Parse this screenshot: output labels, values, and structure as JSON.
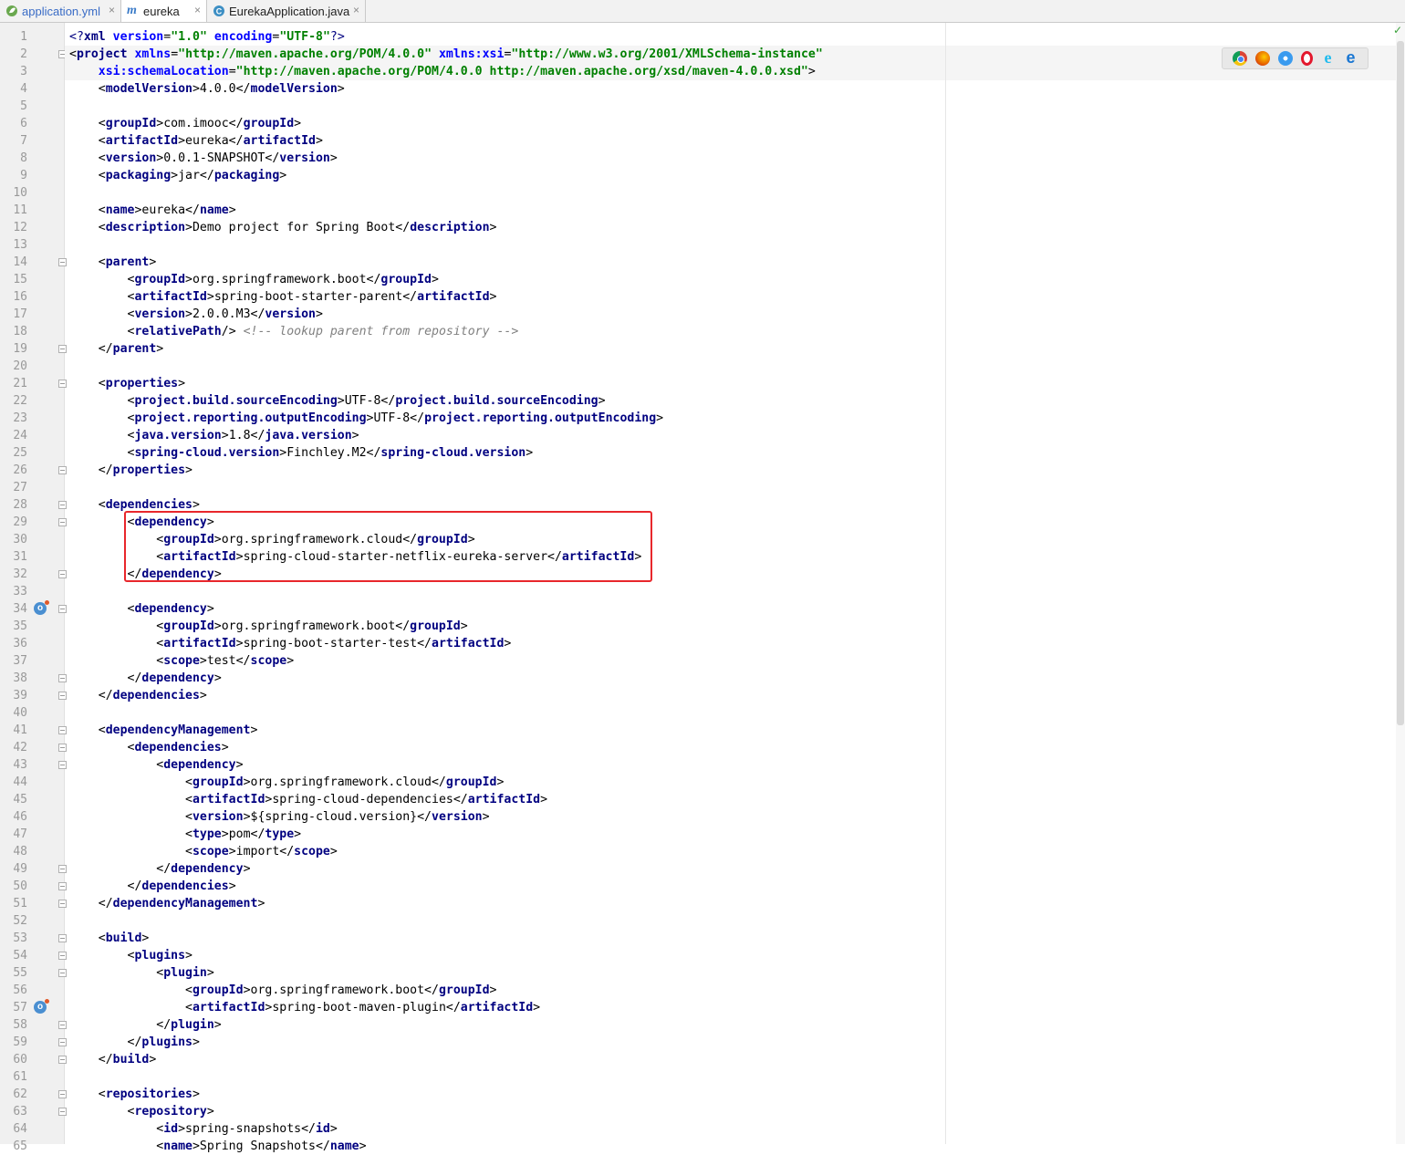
{
  "tabs": [
    {
      "label": "application.yml",
      "icon": "yaml-leaf-icon",
      "active": false
    },
    {
      "label": "eureka",
      "icon": "maven-m-icon",
      "active": true
    },
    {
      "label": "EurekaApplication.java",
      "icon": "java-class-icon",
      "active": false
    }
  ],
  "tab_close_glyph": "×",
  "status_check": "✓",
  "browser_icons": [
    "chrome-icon",
    "firefox-icon",
    "safari-icon",
    "opera-icon",
    "ie-icon",
    "edge-icon"
  ],
  "gutter_icons": [
    {
      "line": 34,
      "name": "run-override-icon"
    },
    {
      "line": 57,
      "name": "run-override-icon"
    }
  ],
  "fold_lines": [
    2,
    14,
    19,
    21,
    26,
    28,
    29,
    32,
    34,
    38,
    39,
    41,
    42,
    43,
    49,
    50,
    51,
    53,
    54,
    55,
    58,
    59,
    60,
    62,
    63
  ],
  "highlight_box": {
    "color": "#e8272c",
    "lines": [
      29,
      32
    ]
  },
  "colors": {
    "tag": "#000080",
    "attribute": "#0000ff",
    "value": "#008000",
    "comment": "#808080"
  },
  "code_lines": [
    [
      {
        "t": "<?",
        "c": "pi"
      },
      {
        "t": "xml ",
        "c": "tag"
      },
      {
        "t": "version",
        "c": "att"
      },
      {
        "t": "=",
        "c": ""
      },
      {
        "t": "\"1.0\"",
        "c": "val"
      },
      {
        "t": " ",
        "c": ""
      },
      {
        "t": "encoding",
        "c": "att"
      },
      {
        "t": "=",
        "c": ""
      },
      {
        "t": "\"UTF-8\"",
        "c": "val"
      },
      {
        "t": "?>",
        "c": "pi"
      }
    ],
    [
      {
        "t": "<",
        "c": ""
      },
      {
        "t": "project ",
        "c": "tag"
      },
      {
        "t": "xmlns",
        "c": "att"
      },
      {
        "t": "=",
        "c": ""
      },
      {
        "t": "\"http://maven.apache.org/POM/4.0.0\"",
        "c": "val"
      },
      {
        "t": " ",
        "c": ""
      },
      {
        "t": "xmlns:xsi",
        "c": "att"
      },
      {
        "t": "=",
        "c": ""
      },
      {
        "t": "\"http://www.w3.org/2001/XMLSchema-instance\"",
        "c": "val"
      }
    ],
    [
      {
        "t": "    ",
        "c": ""
      },
      {
        "t": "xsi:schemaLocation",
        "c": "att"
      },
      {
        "t": "=",
        "c": ""
      },
      {
        "t": "\"http://maven.apache.org/POM/4.0.0 http://maven.apache.org/xsd/maven-4.0.0.xsd\"",
        "c": "val"
      },
      {
        "t": ">",
        "c": ""
      }
    ],
    [
      {
        "t": "    <",
        "c": ""
      },
      {
        "t": "modelVersion",
        "c": "tag"
      },
      {
        "t": ">4.0.0</",
        "c": ""
      },
      {
        "t": "modelVersion",
        "c": "tag"
      },
      {
        "t": ">",
        "c": ""
      }
    ],
    [],
    [
      {
        "t": "    <",
        "c": ""
      },
      {
        "t": "groupId",
        "c": "tag"
      },
      {
        "t": ">com.imooc</",
        "c": ""
      },
      {
        "t": "groupId",
        "c": "tag"
      },
      {
        "t": ">",
        "c": ""
      }
    ],
    [
      {
        "t": "    <",
        "c": ""
      },
      {
        "t": "artifactId",
        "c": "tag"
      },
      {
        "t": ">eureka</",
        "c": ""
      },
      {
        "t": "artifactId",
        "c": "tag"
      },
      {
        "t": ">",
        "c": ""
      }
    ],
    [
      {
        "t": "    <",
        "c": ""
      },
      {
        "t": "version",
        "c": "tag"
      },
      {
        "t": ">0.0.1-SNAPSHOT</",
        "c": ""
      },
      {
        "t": "version",
        "c": "tag"
      },
      {
        "t": ">",
        "c": ""
      }
    ],
    [
      {
        "t": "    <",
        "c": ""
      },
      {
        "t": "packaging",
        "c": "tag"
      },
      {
        "t": ">jar</",
        "c": ""
      },
      {
        "t": "packaging",
        "c": "tag"
      },
      {
        "t": ">",
        "c": ""
      }
    ],
    [],
    [
      {
        "t": "    <",
        "c": ""
      },
      {
        "t": "name",
        "c": "tag"
      },
      {
        "t": ">eureka</",
        "c": ""
      },
      {
        "t": "name",
        "c": "tag"
      },
      {
        "t": ">",
        "c": ""
      }
    ],
    [
      {
        "t": "    <",
        "c": ""
      },
      {
        "t": "description",
        "c": "tag"
      },
      {
        "t": ">Demo project for Spring Boot</",
        "c": ""
      },
      {
        "t": "description",
        "c": "tag"
      },
      {
        "t": ">",
        "c": ""
      }
    ],
    [],
    [
      {
        "t": "    <",
        "c": ""
      },
      {
        "t": "parent",
        "c": "tag"
      },
      {
        "t": ">",
        "c": ""
      }
    ],
    [
      {
        "t": "        <",
        "c": ""
      },
      {
        "t": "groupId",
        "c": "tag"
      },
      {
        "t": ">org.springframework.boot</",
        "c": ""
      },
      {
        "t": "groupId",
        "c": "tag"
      },
      {
        "t": ">",
        "c": ""
      }
    ],
    [
      {
        "t": "        <",
        "c": ""
      },
      {
        "t": "artifactId",
        "c": "tag"
      },
      {
        "t": ">spring-boot-starter-parent</",
        "c": ""
      },
      {
        "t": "artifactId",
        "c": "tag"
      },
      {
        "t": ">",
        "c": ""
      }
    ],
    [
      {
        "t": "        <",
        "c": ""
      },
      {
        "t": "version",
        "c": "tag"
      },
      {
        "t": ">2.0.0.M3</",
        "c": ""
      },
      {
        "t": "version",
        "c": "tag"
      },
      {
        "t": ">",
        "c": ""
      }
    ],
    [
      {
        "t": "        <",
        "c": ""
      },
      {
        "t": "relativePath",
        "c": "tag"
      },
      {
        "t": "/> ",
        "c": ""
      },
      {
        "t": "<!-- lookup parent from repository -->",
        "c": "cmt"
      }
    ],
    [
      {
        "t": "    </",
        "c": ""
      },
      {
        "t": "parent",
        "c": "tag"
      },
      {
        "t": ">",
        "c": ""
      }
    ],
    [],
    [
      {
        "t": "    <",
        "c": ""
      },
      {
        "t": "properties",
        "c": "tag"
      },
      {
        "t": ">",
        "c": ""
      }
    ],
    [
      {
        "t": "        <",
        "c": ""
      },
      {
        "t": "project.build.sourceEncoding",
        "c": "tag"
      },
      {
        "t": ">UTF-8</",
        "c": ""
      },
      {
        "t": "project.build.sourceEncoding",
        "c": "tag"
      },
      {
        "t": ">",
        "c": ""
      }
    ],
    [
      {
        "t": "        <",
        "c": ""
      },
      {
        "t": "project.reporting.outputEncoding",
        "c": "tag"
      },
      {
        "t": ">UTF-8</",
        "c": ""
      },
      {
        "t": "project.reporting.outputEncoding",
        "c": "tag"
      },
      {
        "t": ">",
        "c": ""
      }
    ],
    [
      {
        "t": "        <",
        "c": ""
      },
      {
        "t": "java.version",
        "c": "tag"
      },
      {
        "t": ">1.8</",
        "c": ""
      },
      {
        "t": "java.version",
        "c": "tag"
      },
      {
        "t": ">",
        "c": ""
      }
    ],
    [
      {
        "t": "        <",
        "c": ""
      },
      {
        "t": "spring-cloud.version",
        "c": "tag"
      },
      {
        "t": ">Finchley.M2</",
        "c": ""
      },
      {
        "t": "spring-cloud.version",
        "c": "tag"
      },
      {
        "t": ">",
        "c": ""
      }
    ],
    [
      {
        "t": "    </",
        "c": ""
      },
      {
        "t": "properties",
        "c": "tag"
      },
      {
        "t": ">",
        "c": ""
      }
    ],
    [],
    [
      {
        "t": "    <",
        "c": ""
      },
      {
        "t": "dependencies",
        "c": "tag"
      },
      {
        "t": ">",
        "c": ""
      }
    ],
    [
      {
        "t": "        <",
        "c": ""
      },
      {
        "t": "dependency",
        "c": "tag"
      },
      {
        "t": ">",
        "c": ""
      }
    ],
    [
      {
        "t": "            <",
        "c": ""
      },
      {
        "t": "groupId",
        "c": "tag"
      },
      {
        "t": ">org.springframework.cloud</",
        "c": ""
      },
      {
        "t": "groupId",
        "c": "tag"
      },
      {
        "t": ">",
        "c": ""
      }
    ],
    [
      {
        "t": "            <",
        "c": ""
      },
      {
        "t": "artifactId",
        "c": "tag"
      },
      {
        "t": ">spring-cloud-starter-netflix-eureka-server</",
        "c": ""
      },
      {
        "t": "artifactId",
        "c": "tag"
      },
      {
        "t": ">",
        "c": ""
      }
    ],
    [
      {
        "t": "        </",
        "c": ""
      },
      {
        "t": "dependency",
        "c": "tag"
      },
      {
        "t": ">",
        "c": ""
      }
    ],
    [],
    [
      {
        "t": "        <",
        "c": ""
      },
      {
        "t": "dependency",
        "c": "tag"
      },
      {
        "t": ">",
        "c": ""
      }
    ],
    [
      {
        "t": "            <",
        "c": ""
      },
      {
        "t": "groupId",
        "c": "tag"
      },
      {
        "t": ">org.springframework.boot</",
        "c": ""
      },
      {
        "t": "groupId",
        "c": "tag"
      },
      {
        "t": ">",
        "c": ""
      }
    ],
    [
      {
        "t": "            <",
        "c": ""
      },
      {
        "t": "artifactId",
        "c": "tag"
      },
      {
        "t": ">spring-boot-starter-test</",
        "c": ""
      },
      {
        "t": "artifactId",
        "c": "tag"
      },
      {
        "t": ">",
        "c": ""
      }
    ],
    [
      {
        "t": "            <",
        "c": ""
      },
      {
        "t": "scope",
        "c": "tag"
      },
      {
        "t": ">test</",
        "c": ""
      },
      {
        "t": "scope",
        "c": "tag"
      },
      {
        "t": ">",
        "c": ""
      }
    ],
    [
      {
        "t": "        </",
        "c": ""
      },
      {
        "t": "dependency",
        "c": "tag"
      },
      {
        "t": ">",
        "c": ""
      }
    ],
    [
      {
        "t": "    </",
        "c": ""
      },
      {
        "t": "dependencies",
        "c": "tag"
      },
      {
        "t": ">",
        "c": ""
      }
    ],
    [],
    [
      {
        "t": "    <",
        "c": ""
      },
      {
        "t": "dependencyManagement",
        "c": "tag"
      },
      {
        "t": ">",
        "c": ""
      }
    ],
    [
      {
        "t": "        <",
        "c": ""
      },
      {
        "t": "dependencies",
        "c": "tag"
      },
      {
        "t": ">",
        "c": ""
      }
    ],
    [
      {
        "t": "            <",
        "c": ""
      },
      {
        "t": "dependency",
        "c": "tag"
      },
      {
        "t": ">",
        "c": ""
      }
    ],
    [
      {
        "t": "                <",
        "c": ""
      },
      {
        "t": "groupId",
        "c": "tag"
      },
      {
        "t": ">org.springframework.cloud</",
        "c": ""
      },
      {
        "t": "groupId",
        "c": "tag"
      },
      {
        "t": ">",
        "c": ""
      }
    ],
    [
      {
        "t": "                <",
        "c": ""
      },
      {
        "t": "artifactId",
        "c": "tag"
      },
      {
        "t": ">spring-cloud-dependencies</",
        "c": ""
      },
      {
        "t": "artifactId",
        "c": "tag"
      },
      {
        "t": ">",
        "c": ""
      }
    ],
    [
      {
        "t": "                <",
        "c": ""
      },
      {
        "t": "version",
        "c": "tag"
      },
      {
        "t": ">${spring-cloud.version}</",
        "c": ""
      },
      {
        "t": "version",
        "c": "tag"
      },
      {
        "t": ">",
        "c": ""
      }
    ],
    [
      {
        "t": "                <",
        "c": ""
      },
      {
        "t": "type",
        "c": "tag"
      },
      {
        "t": ">pom</",
        "c": ""
      },
      {
        "t": "type",
        "c": "tag"
      },
      {
        "t": ">",
        "c": ""
      }
    ],
    [
      {
        "t": "                <",
        "c": ""
      },
      {
        "t": "scope",
        "c": "tag"
      },
      {
        "t": ">import</",
        "c": ""
      },
      {
        "t": "scope",
        "c": "tag"
      },
      {
        "t": ">",
        "c": ""
      }
    ],
    [
      {
        "t": "            </",
        "c": ""
      },
      {
        "t": "dependency",
        "c": "tag"
      },
      {
        "t": ">",
        "c": ""
      }
    ],
    [
      {
        "t": "        </",
        "c": ""
      },
      {
        "t": "dependencies",
        "c": "tag"
      },
      {
        "t": ">",
        "c": ""
      }
    ],
    [
      {
        "t": "    </",
        "c": ""
      },
      {
        "t": "dependencyManagement",
        "c": "tag"
      },
      {
        "t": ">",
        "c": ""
      }
    ],
    [],
    [
      {
        "t": "    <",
        "c": ""
      },
      {
        "t": "build",
        "c": "tag"
      },
      {
        "t": ">",
        "c": ""
      }
    ],
    [
      {
        "t": "        <",
        "c": ""
      },
      {
        "t": "plugins",
        "c": "tag"
      },
      {
        "t": ">",
        "c": ""
      }
    ],
    [
      {
        "t": "            <",
        "c": ""
      },
      {
        "t": "plugin",
        "c": "tag"
      },
      {
        "t": ">",
        "c": ""
      }
    ],
    [
      {
        "t": "                <",
        "c": ""
      },
      {
        "t": "groupId",
        "c": "tag"
      },
      {
        "t": ">org.springframework.boot</",
        "c": ""
      },
      {
        "t": "groupId",
        "c": "tag"
      },
      {
        "t": ">",
        "c": ""
      }
    ],
    [
      {
        "t": "                <",
        "c": ""
      },
      {
        "t": "artifactId",
        "c": "tag"
      },
      {
        "t": ">spring-boot-maven-plugin</",
        "c": ""
      },
      {
        "t": "artifactId",
        "c": "tag"
      },
      {
        "t": ">",
        "c": ""
      }
    ],
    [
      {
        "t": "            </",
        "c": ""
      },
      {
        "t": "plugin",
        "c": "tag"
      },
      {
        "t": ">",
        "c": ""
      }
    ],
    [
      {
        "t": "        </",
        "c": ""
      },
      {
        "t": "plugins",
        "c": "tag"
      },
      {
        "t": ">",
        "c": ""
      }
    ],
    [
      {
        "t": "    </",
        "c": ""
      },
      {
        "t": "build",
        "c": "tag"
      },
      {
        "t": ">",
        "c": ""
      }
    ],
    [],
    [
      {
        "t": "    <",
        "c": ""
      },
      {
        "t": "repositories",
        "c": "tag"
      },
      {
        "t": ">",
        "c": ""
      }
    ],
    [
      {
        "t": "        <",
        "c": ""
      },
      {
        "t": "repository",
        "c": "tag"
      },
      {
        "t": ">",
        "c": ""
      }
    ],
    [
      {
        "t": "            <",
        "c": ""
      },
      {
        "t": "id",
        "c": "tag"
      },
      {
        "t": ">spring-snapshots</",
        "c": ""
      },
      {
        "t": "id",
        "c": "tag"
      },
      {
        "t": ">",
        "c": ""
      }
    ],
    [
      {
        "t": "            <",
        "c": ""
      },
      {
        "t": "name",
        "c": "tag"
      },
      {
        "t": ">Spring Snapshots</",
        "c": ""
      },
      {
        "t": "name",
        "c": "tag"
      },
      {
        "t": ">",
        "c": ""
      }
    ]
  ]
}
